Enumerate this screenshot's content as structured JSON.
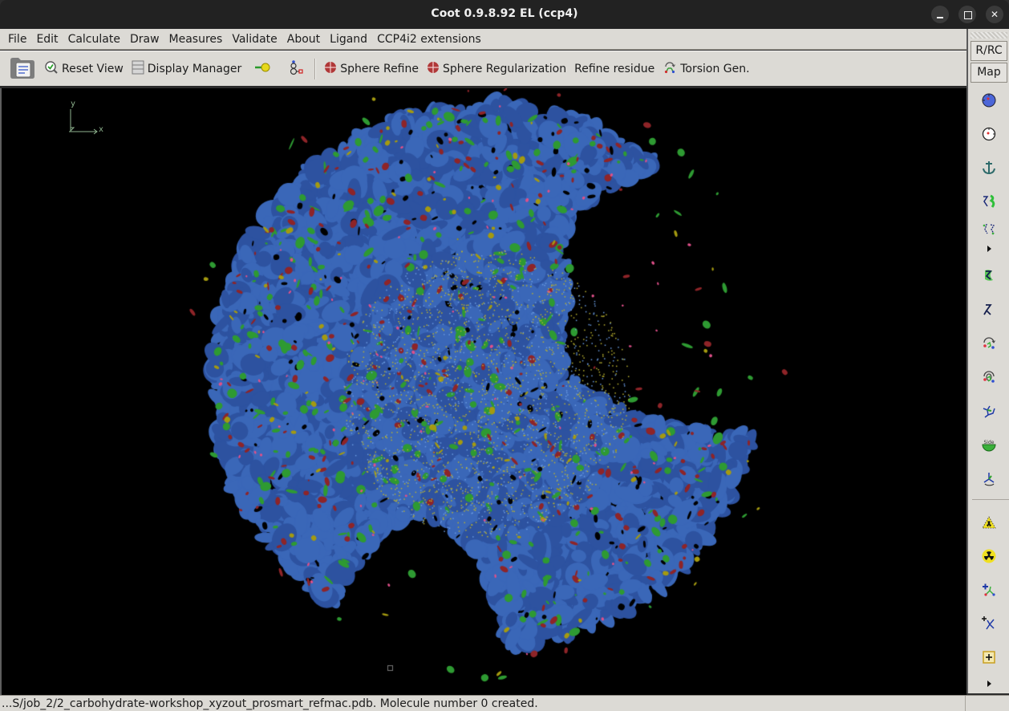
{
  "window": {
    "title": "Coot 0.9.8.92 EL (ccp4)",
    "controls": {
      "minimize": "minimize",
      "maximize": "maximize",
      "close": "close"
    }
  },
  "menubar": {
    "items": [
      "File",
      "Edit",
      "Calculate",
      "Draw",
      "Measures",
      "Validate",
      "About",
      "Ligand",
      "CCP4i2 extensions"
    ]
  },
  "toolbar": {
    "items": [
      {
        "icon": "file-manager-icon",
        "label": ""
      },
      {
        "icon": "reset-view-icon",
        "label": "Reset View"
      },
      {
        "icon": "display-manager-icon",
        "label": "Display Manager"
      },
      {
        "icon": "go-to-atom-icon",
        "label": ""
      },
      {
        "icon": "ligand-molecule-icon",
        "label": ""
      },
      {
        "icon": "sphere-refine-icon",
        "label": "Sphere Refine"
      },
      {
        "icon": "sphere-regularization-icon",
        "label": "Sphere Regularization"
      },
      {
        "icon": "",
        "label": "Refine residue"
      },
      {
        "icon": "torsion-gen-icon",
        "label": "Torsion Gen."
      }
    ]
  },
  "sidebar": {
    "text_buttons": [
      "R/RC",
      "Map"
    ],
    "icons": [
      "rotate-translate-zone-icon",
      "auto-fit-rotamer-icon",
      "anchor-icon",
      "mutate-autofit-icon",
      "backbone-torsion-icon",
      "expand-arrow-icon",
      "add-terminal-residue-icon",
      "add-alt-conf-icon",
      "rotamer-icon",
      "edit-chi-angles-icon",
      "flip-peptide-icon",
      "side-chain-180-icon",
      "edit-backbone-torsion-icon",
      "delete-icon",
      "delete-item-icon",
      "place-atom-icon",
      "add-atom-at-pointer-icon",
      "pointer-position-icon",
      "more-arrow-icon"
    ]
  },
  "viewport": {
    "axes": {
      "x": "x",
      "y": "y",
      "z": "z"
    },
    "colors": {
      "background": "#000000",
      "map_blue": "#3a67b8",
      "map_blue_dark": "#2d52a0",
      "green": "#2e9a32",
      "red": "#8e2428",
      "yellow": "#a49a10",
      "pink": "#e0508a"
    }
  },
  "statusbar": {
    "text": "...S/job_2/2_carbohydrate-workshop_xyzout_prosmart_refmac.pdb.  Molecule number 0 created."
  }
}
